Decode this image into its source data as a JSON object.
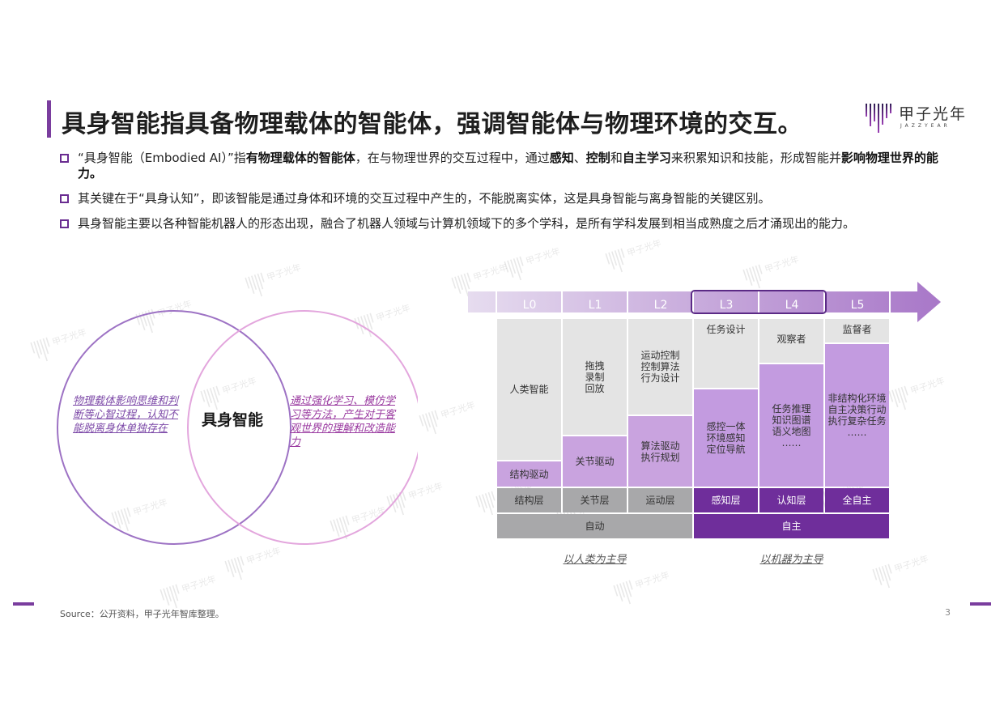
{
  "title": "具身智能指具备物理载体的智能体，强调智能体与物理环境的交互。",
  "logo": {
    "cn": "甲子光年",
    "en": "JAZZYEAR"
  },
  "bullets": [
    {
      "segments": [
        {
          "t": "“具身智能（Embodied AI）”指",
          "b": false
        },
        {
          "t": "有物理载体的智能体",
          "b": true
        },
        {
          "t": "，在与物理世界的交互过程中，通过",
          "b": false
        },
        {
          "t": "感知",
          "b": true
        },
        {
          "t": "、",
          "b": false
        },
        {
          "t": "控制",
          "b": true
        },
        {
          "t": "和",
          "b": false
        },
        {
          "t": "自主学习",
          "b": true
        },
        {
          "t": "来积累知识和技能，形成智能并",
          "b": false
        },
        {
          "t": "影响物理世界的能力。",
          "b": true
        }
      ]
    },
    {
      "segments": [
        {
          "t": "其关键在于“具身认知”，即该智能是通过身体和环境的交互过程中产生的，不能脱离实体，这是具身智能与离身智能的关键区别。",
          "b": false
        }
      ]
    },
    {
      "segments": [
        {
          "t": "具身智能主要以各种智能机器人的形态出现，融合了机器人领域与计算机领域下的多个学科，是所有学科发展到相当成熟度之后才涌现出的能力。",
          "b": false
        }
      ]
    }
  ],
  "venn": {
    "center": "具身智能",
    "left": "物理载体影响思维和判断等心智过程，认知不能脱离身体单独存在",
    "right": "通过强化学习、模仿学习等方法，产生对于客观世界的理解和改造能力"
  },
  "levels": {
    "labels": [
      "L0",
      "L1",
      "L2",
      "L3",
      "L4",
      "L5"
    ],
    "highlighted": [
      "L3",
      "L4"
    ],
    "upper": [
      "人类智能",
      "拖拽\n录制\n回放",
      "运动控制\n控制算法\n行为设计",
      "任务设计",
      "观察者",
      "监督者"
    ],
    "lower": [
      "结构驱动",
      "关节驱动",
      "算法驱动\n执行规划",
      "感控一体\n环境感知\n定位导航",
      "任务推理\n知识图谱\n语义地图\n……",
      "非结构化环境\n自主决策行动\n执行复杂任务\n……"
    ],
    "lower_fraction": [
      0.15,
      0.3,
      0.42,
      0.58,
      0.73,
      0.85
    ],
    "layers": [
      "结构层",
      "关节层",
      "运动层",
      "感知层",
      "认知层",
      "全自主"
    ],
    "groups": [
      "自动",
      "自主"
    ],
    "captions": [
      "以人类为主导",
      "以机器为主导"
    ],
    "colors": {
      "grey": "#e4e4e4",
      "grey_dark": "#a8a8aa",
      "purple_light": "#c9a3df",
      "purple_dark": "#6f2e9b"
    }
  },
  "source": "Source：公开资料，甲子光年智库整理。",
  "page_number": "3"
}
